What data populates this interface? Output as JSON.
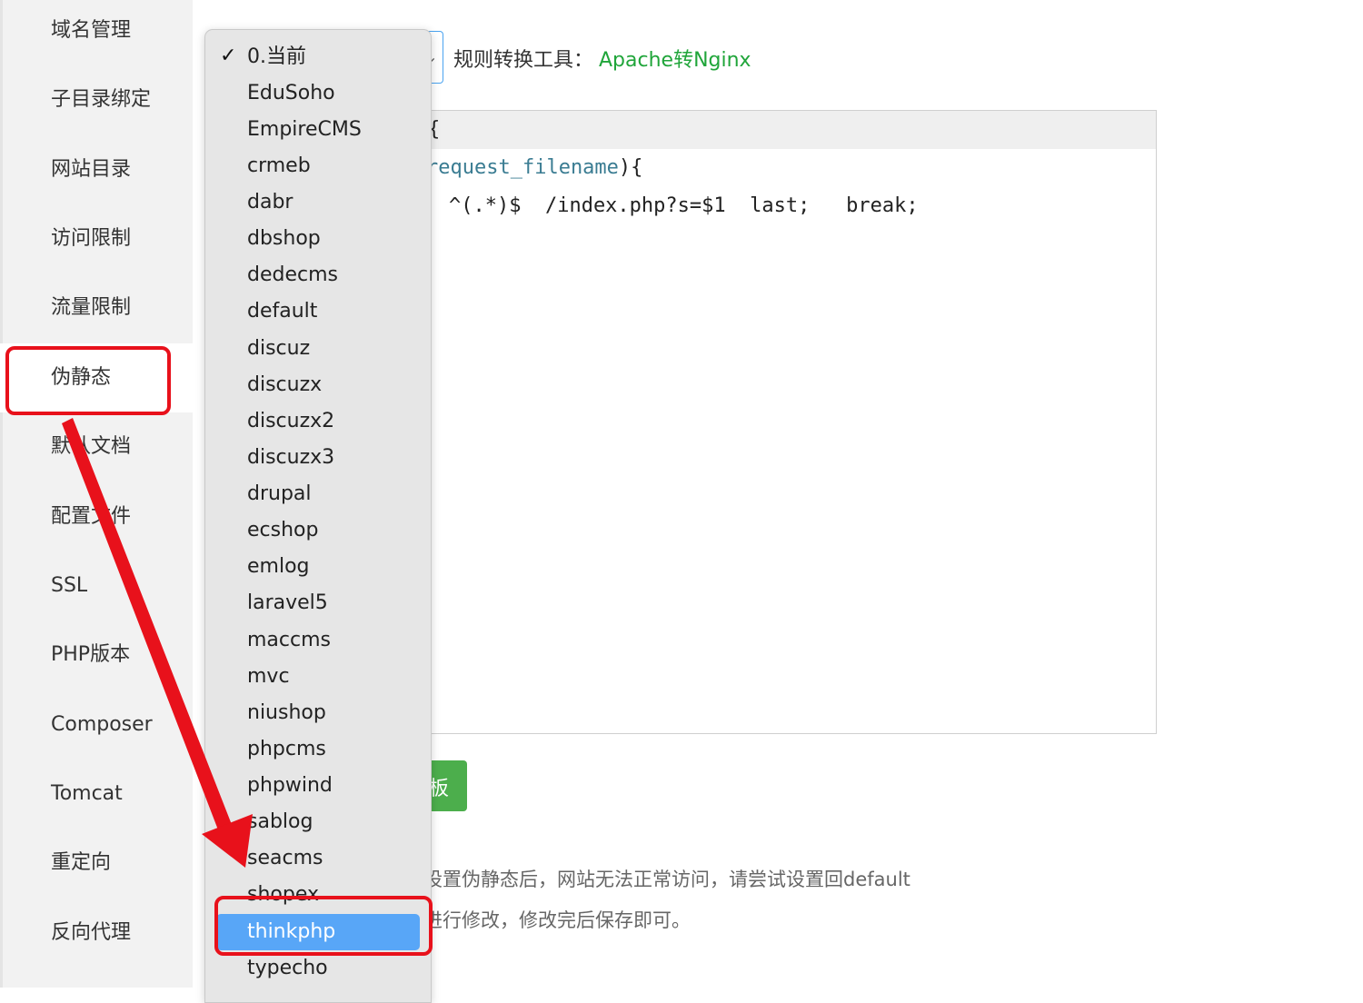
{
  "sidebar": {
    "items": [
      {
        "label": "域名管理"
      },
      {
        "label": "子目录绑定"
      },
      {
        "label": "网站目录"
      },
      {
        "label": "访问限制"
      },
      {
        "label": "流量限制"
      },
      {
        "label": "伪静态"
      },
      {
        "label": "默认文档"
      },
      {
        "label": "配置文件"
      },
      {
        "label": "SSL"
      },
      {
        "label": "PHP版本"
      },
      {
        "label": "Composer"
      },
      {
        "label": "Tomcat"
      },
      {
        "label": "重定向"
      },
      {
        "label": "反向代理"
      }
    ],
    "active": "伪静态"
  },
  "toolbar": {
    "converter_label": "规则转换工具：",
    "converter_link": "Apache转Nginx"
  },
  "editor": {
    "line1_tail": "{",
    "line2_var": "request_filename",
    "line2_tail": "){",
    "line3": "^(.*)$  /index.php?s=$1  last;   break;"
  },
  "save_button": {
    "label": "板"
  },
  "notes": {
    "line1": "设置伪静态后，网站无法正常访问，请尝试设置回default",
    "line2": "进行修改，修改完后保存即可。"
  },
  "dropdown": {
    "check_icon": "✓",
    "selected": "thinkphp",
    "options": [
      "0.当前",
      "EduSoho",
      "EmpireCMS",
      "crmeb",
      "dabr",
      "dbshop",
      "dedecms",
      "default",
      "discuz",
      "discuzx",
      "discuzx2",
      "discuzx3",
      "drupal",
      "ecshop",
      "emlog",
      "laravel5",
      "maccms",
      "mvc",
      "niushop",
      "phpcms",
      "phpwind",
      "sablog",
      "seacms",
      "shopex",
      "thinkphp",
      "typecho"
    ]
  },
  "colors": {
    "accent_green": "#20a53a",
    "annotation_red": "#e8111b",
    "highlight_blue": "#58a6f7"
  }
}
